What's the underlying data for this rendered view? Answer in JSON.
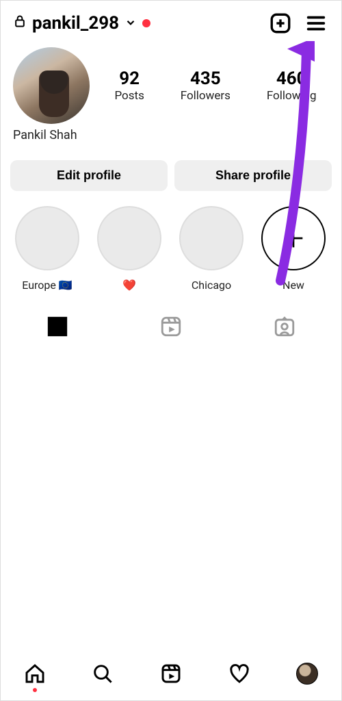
{
  "header": {
    "username": "pankil_298"
  },
  "profile": {
    "display_name": "Pankil Shah",
    "stats": {
      "posts": {
        "count": "92",
        "label": "Posts"
      },
      "followers": {
        "count": "435",
        "label": "Followers"
      },
      "following": {
        "count": "460",
        "label": "Following"
      }
    }
  },
  "buttons": {
    "edit": "Edit profile",
    "share": "Share profile"
  },
  "highlights": [
    {
      "label": "Europe 🇪🇺"
    },
    {
      "label": "❤️"
    },
    {
      "label": "Chicago"
    },
    {
      "label": "New",
      "is_new": true
    }
  ],
  "icons": {
    "lock": "lock-icon",
    "chevron": "chevron-down-icon",
    "create": "create-icon",
    "menu": "menu-icon",
    "grid": "grid-icon",
    "reels": "reels-icon",
    "tagged": "tagged-icon",
    "home": "home-icon",
    "search": "search-icon",
    "heart": "heart-icon"
  }
}
